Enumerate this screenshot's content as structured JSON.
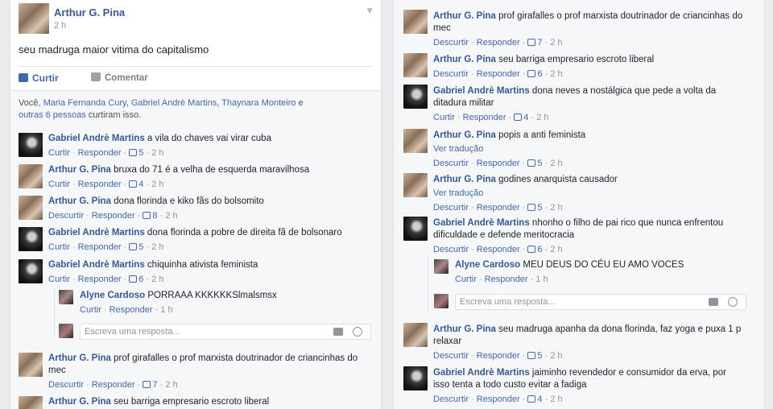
{
  "post": {
    "author": "Arthur G. Pina",
    "time": "2 h",
    "text": "seu madruga maior vitima do capitalismo",
    "like_label": "Curtir",
    "comment_label": "Comentar",
    "likes": {
      "you": "Você,",
      "names": [
        "Maria Fernanda Cury",
        "Gabriel Andrè Martins",
        "Thaynara Monteiro"
      ],
      "sep1": ", ",
      "sep2": ", ",
      "and": " e",
      "others": "outras 6 pessoas",
      "tail": " curtiram isso."
    }
  },
  "left_comments": [
    {
      "author": "Gabriel Andrè Martins",
      "text": "a vila do chaves vai virar cuba",
      "a1": "Curtir",
      "a2": "Responder",
      "likes": "5",
      "time": "2 h"
    },
    {
      "author": "Arthur G. Pina",
      "text": "bruxa do 71 é a velha de esquerda maravilhosa",
      "a1": "Curtir",
      "a2": "Responder",
      "likes": "4",
      "time": "2 h"
    },
    {
      "author": "Arthur G. Pina",
      "text": "dona florinda e kiko fãs do bolsomito",
      "a1": "Descurtir",
      "a2": "Responder",
      "likes": "8",
      "time": "2 h"
    },
    {
      "author": "Gabriel Andrè Martins",
      "text": "dona florinda a pobre de direita fã de bolsonaro",
      "a1": "Curtir",
      "a2": "Responder",
      "likes": "5",
      "time": "2 h"
    },
    {
      "author": "Gabriel Andrè Martins",
      "text": "chiquinha ativista feminista",
      "a1": "Curtir",
      "a2": "Responder",
      "likes": "6",
      "time": "2 h"
    },
    {
      "author": "Arthur G. Pina",
      "text": "prof girafalles o prof marxista doutrinador de criancinhas do mec",
      "a1": "Descurtir",
      "a2": "Responder",
      "likes": "7",
      "time": "2 h"
    },
    {
      "author": "Arthur G. Pina",
      "text": "seu barriga empresario escroto liberal"
    }
  ],
  "left_reply": {
    "author": "Alyne Cardoso",
    "text": "PORRAAA KKKKKKSlmalsmsx",
    "a1": "Curtir",
    "a2": "Responder",
    "time": "1 h"
  },
  "reply_placeholder": "Escreva uma resposta...",
  "right_comments": [
    {
      "author": "Arthur G. Pina",
      "text": "prof girafalles o prof marxista doutrinador de criancinhas do mec",
      "a1": "Descurtir",
      "a2": "Responder",
      "likes": "7",
      "time": "2 h"
    },
    {
      "author": "Arthur G. Pina",
      "text": "seu barriga empresario escroto liberal",
      "a1": "Descurtir",
      "a2": "Responder",
      "likes": "6",
      "time": "2 h"
    },
    {
      "author": "Gabriel Andrè Martins",
      "text": "dona neves a nostálgica que pede a volta da ditadura militar",
      "a1": "Curtir",
      "a2": "Responder",
      "likes": "4",
      "time": "2 h"
    },
    {
      "author": "Arthur G. Pina",
      "text": "popis a anti feminista",
      "translate": "Ver tradução",
      "a1": "Descurtir",
      "a2": "Responder",
      "likes": "5",
      "time": "2 h"
    },
    {
      "author": "Arthur G. Pina",
      "text": "godines anarquista causador",
      "translate": "Ver tradução",
      "a1": "Descurtir",
      "a2": "Responder",
      "likes": "5",
      "time": "2 h"
    },
    {
      "author": "Gabriel Andrè Martins",
      "text": "nhonho o filho de pai rico que nunca enfrentou dificuldade e defende meritocracia",
      "a1": "Descurtir",
      "a2": "Responder",
      "likes": "6",
      "time": "2 h"
    },
    {
      "author": "Arthur G. Pina",
      "text": "seu madruga apanha da dona florinda, faz yoga e puxa 1 p relaxar",
      "a1": "Descurtir",
      "a2": "Responder",
      "likes": "5",
      "time": "2 h"
    },
    {
      "author": "Gabriel Andrè Martins",
      "text": "jaiminho revendedor e consumidor da erva, por isso tenta a todo custo evitar a fadiga",
      "a1": "Descurtir",
      "a2": "Responder",
      "likes": "4",
      "time": "2 h"
    }
  ],
  "right_reply": {
    "author": "Alyne Cardoso",
    "text": "MEU DEUS DO CÉU EU AMO VOCES",
    "a1": "Curtir",
    "a2": "Responder",
    "time": "1 h"
  },
  "icons": {
    "like": "thumbs-up-icon",
    "comment": "speech-bubble-icon",
    "camera": "camera-icon",
    "emoji": "smiley-icon",
    "menu": "chevron-down-icon"
  },
  "colors": {
    "link": "#365899",
    "accent": "#4267b2",
    "muted": "#90949c"
  }
}
